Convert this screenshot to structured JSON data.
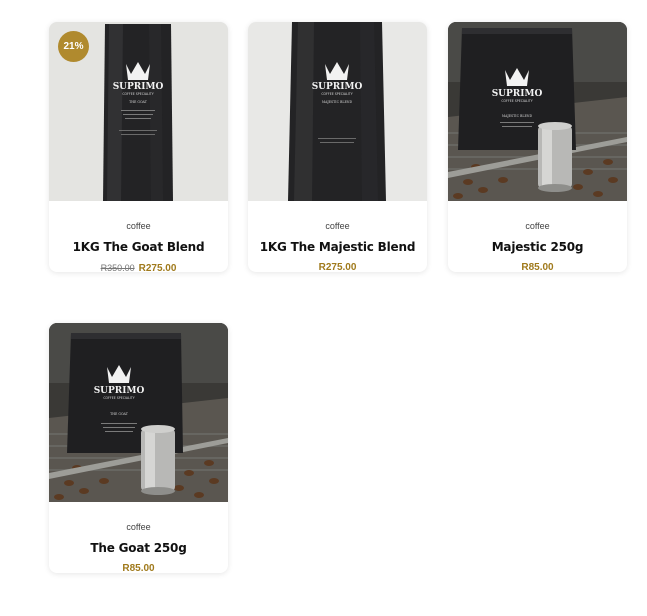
{
  "colors": {
    "accent": "#b08a2e",
    "price": "#a07a1c",
    "title": "#111111"
  },
  "products": [
    {
      "category": "coffee",
      "title": "1KG The Goat Blend",
      "old_price": "R350.00",
      "price": "R275.00",
      "badge": "21%",
      "bag_brand": "SUPRIMO",
      "bag_sub": "COFFEE SPECIALITY",
      "bag_variant": "THE GOAT"
    },
    {
      "category": "coffee",
      "title": "1KG The Majestic Blend",
      "price": "R275.00",
      "bag_brand": "SUPRIMO",
      "bag_sub": "COFFEE SPECIALITY",
      "bag_variant": "MAJESTIC BLEND"
    },
    {
      "category": "coffee",
      "title": "Majestic 250g",
      "price": "R85.00",
      "bag_brand": "SUPRIMO",
      "bag_sub": "COFFEE SPECIALITY",
      "bag_variant": "MAJESTIC BLEND"
    },
    {
      "category": "coffee",
      "title": "The Goat 250g",
      "price": "R85.00",
      "bag_brand": "SUPRIMO",
      "bag_sub": "COFFEE SPECIALITY",
      "bag_variant": "THE GOAT"
    }
  ]
}
